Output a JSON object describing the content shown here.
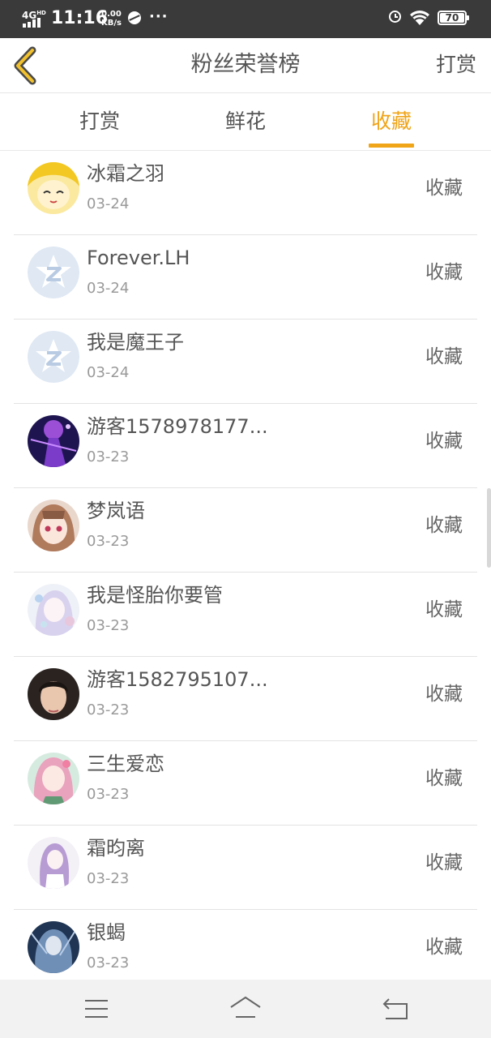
{
  "status_bar": {
    "network": "4G",
    "network_sup": "HD",
    "time": "11:16",
    "speed_value": "0.00",
    "speed_unit": "KB/s",
    "more": "···",
    "battery": "70"
  },
  "header": {
    "title": "粉丝荣誉榜",
    "action": "打赏",
    "back_icon": "chevron-left-icon"
  },
  "tabs": [
    {
      "label": "打赏",
      "active": false
    },
    {
      "label": "鲜花",
      "active": false
    },
    {
      "label": "收藏",
      "active": true
    }
  ],
  "accent_color": "#f0a418",
  "list": [
    {
      "name": "冰霜之羽",
      "date": "03-24",
      "type": "收藏",
      "avatar": "anime-yellow"
    },
    {
      "name": "Forever.LH",
      "date": "03-24",
      "type": "收藏",
      "avatar": "default-z"
    },
    {
      "name": "我是魔王子",
      "date": "03-24",
      "type": "收藏",
      "avatar": "default-z"
    },
    {
      "name": "游客1578978177...",
      "date": "03-23",
      "type": "收藏",
      "avatar": "anime-purple"
    },
    {
      "name": "梦岚语",
      "date": "03-23",
      "type": "收藏",
      "avatar": "anime-pink"
    },
    {
      "name": "我是怪胎你要管",
      "date": "03-23",
      "type": "收藏",
      "avatar": "anime-pastel"
    },
    {
      "name": "游客1582795107...",
      "date": "03-23",
      "type": "收藏",
      "avatar": "photo-person"
    },
    {
      "name": "三生爱恋",
      "date": "03-23",
      "type": "收藏",
      "avatar": "anime-pinkgreen"
    },
    {
      "name": "霜昀离",
      "date": "03-23",
      "type": "收藏",
      "avatar": "anime-lavender"
    },
    {
      "name": "银蝎",
      "date": "03-23",
      "type": "收藏",
      "avatar": "anime-blue"
    }
  ],
  "nav_bar": {
    "menu_icon": "menu-icon",
    "home_icon": "home-icon",
    "back_icon": "back-icon"
  }
}
